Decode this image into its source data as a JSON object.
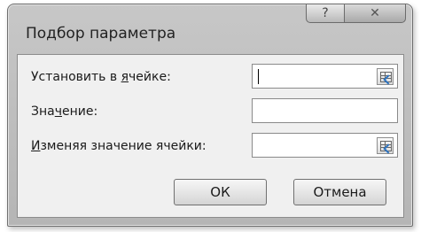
{
  "window": {
    "title": "Подбор параметра",
    "help_symbol": "?",
    "close_symbol": "✕"
  },
  "fields": [
    {
      "label_pre": "Установить в ",
      "label_ul": "я",
      "label_post": "чейке:",
      "value": ""
    },
    {
      "label_pre": "Зна",
      "label_ul": "ч",
      "label_post": "ение:",
      "value": ""
    },
    {
      "label_pre": "",
      "label_ul": "И",
      "label_post": "зменяя значение ячейки:",
      "value": ""
    }
  ],
  "buttons": {
    "ok": "ОК",
    "cancel": "Отмена"
  }
}
